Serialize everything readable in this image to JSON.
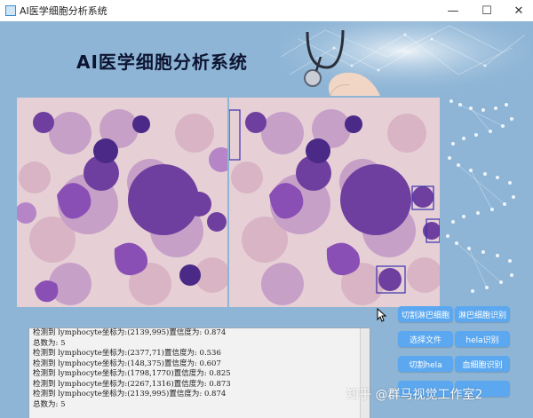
{
  "window": {
    "title": "AI医学细胞分析系统",
    "minimize_glyph": "—",
    "maximize_glyph": "☐",
    "close_glyph": "✕"
  },
  "header": {
    "title": "AI医学细胞分析系统"
  },
  "log": {
    "lines": [
      "检测到 lymphocyte坐标为:(2139,995)置信度为: 0.874",
      "总数为: 5",
      "检测到 lymphocyte坐标为:(2377,71)置信度为: 0.536",
      "检测到 lymphocyte坐标为:(148,375)置信度为: 0.607",
      "检测到 lymphocyte坐标为:(1798,1770)置信度为: 0.825",
      "检测到 lymphocyte坐标为:(2267,1316)置信度为: 0.873",
      "检测到 lymphocyte坐标为:(2139,995)置信度为: 0.874",
      "总数为: 5"
    ]
  },
  "buttons": {
    "cut_lymphocyte": "切割淋巴细胞",
    "identify_lymphocyte": "淋巴细胞识别",
    "select_file": "选择文件",
    "identify_hela": "hela识别",
    "cut_hela": "切割hela",
    "identify_blood": "血细胞识别",
    "extra_left": "",
    "extra_right": ""
  },
  "watermark": "知乎 @群马视觉工作室2",
  "colors": {
    "background": "#8eb5d6",
    "button": "#5ba8f0",
    "title": "#0d1431",
    "detection_box": "#3b2fb0"
  }
}
